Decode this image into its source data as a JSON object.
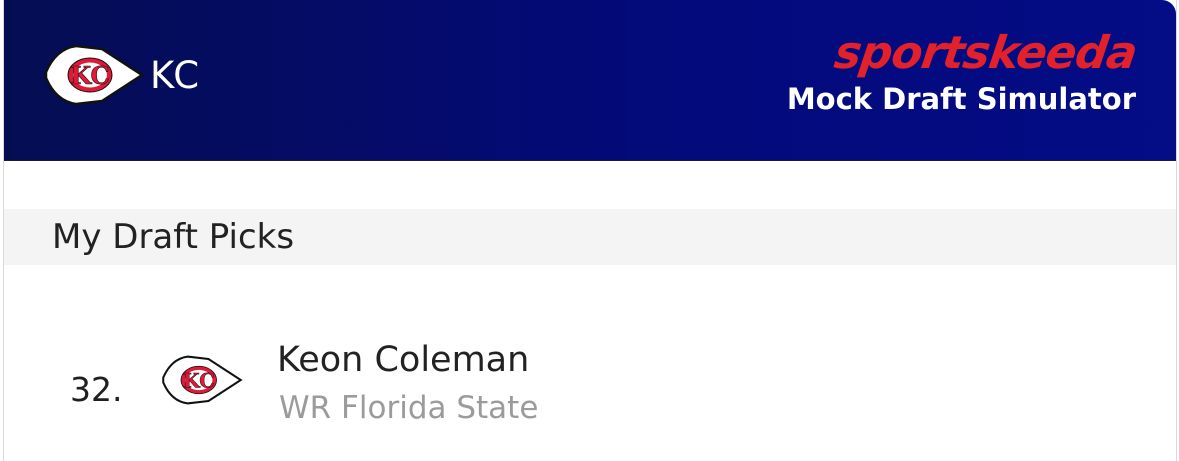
{
  "header": {
    "team_abbr": "KC",
    "team_logo_icon": "kc-arrowhead-icon",
    "brand_name": "sportskeeda",
    "subtitle": "Mock Draft Simulator",
    "colors": {
      "header_bg": "#04097a",
      "brand_red": "#e2212b",
      "chiefs_red": "#e31837"
    }
  },
  "section": {
    "title": "My Draft Picks"
  },
  "picks": [
    {
      "number": "32.",
      "team_logo_icon": "kc-arrowhead-icon",
      "player_name": "Keon Coleman",
      "position_school": "WR Florida State"
    }
  ]
}
